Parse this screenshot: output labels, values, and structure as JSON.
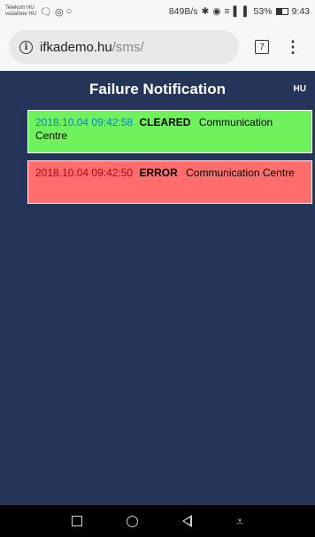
{
  "status_bar": {
    "carrier_1": "Telekom HU",
    "carrier_2": "vodafone HU",
    "net_speed": "849B/s",
    "battery_percent": "53%",
    "time": "9:43",
    "icons": [
      "messenger-icon",
      "target-icon",
      "ring-icon",
      "bluetooth-icon",
      "eye-icon",
      "wifi-icon",
      "signal-icon",
      "signal-icon",
      "battery-icon"
    ]
  },
  "browser": {
    "url_host": "ifkademo.hu",
    "url_path": "/sms/",
    "tab_count": "7"
  },
  "page": {
    "title": "Failure Notification",
    "language_button": "HU",
    "background_color": "#253559"
  },
  "notifications": [
    {
      "timestamp": "2018.10.04 09:42:58",
      "status": "CLEARED",
      "source": "Communication Centre",
      "color": "#6ff25c"
    },
    {
      "timestamp": "2018.10.04 09:42:50",
      "status": "ERROR",
      "source": "Communication Centre",
      "color": "#ff6d6d"
    }
  ],
  "nav_bar": {
    "icons": [
      "recent-apps-icon",
      "home-icon",
      "back-icon",
      "notification-pull-icon"
    ]
  }
}
